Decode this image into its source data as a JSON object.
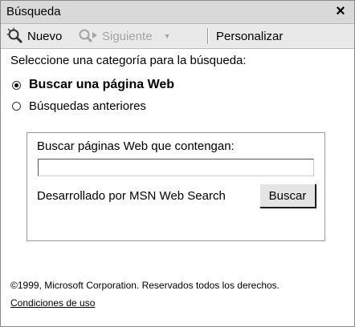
{
  "window": {
    "title": "Búsqueda",
    "close_glyph": "×"
  },
  "toolbar": {
    "new_label": "Nuevo",
    "new_icon": "search-new-icon",
    "next_label": "Siguiente",
    "next_icon": "search-next-icon",
    "dropdown_glyph": "▼",
    "customize_label": "Personalizar"
  },
  "main": {
    "prompt": "Seleccione una categoría para la búsqueda:",
    "options": [
      {
        "label": "Buscar una página Web",
        "selected": true
      },
      {
        "label": "Búsquedas anteriores",
        "selected": false
      }
    ],
    "search_box": {
      "label": "Buscar páginas Web que contengan:",
      "value": "",
      "powered_by": "Desarrollado por MSN Web Search",
      "button_label": "Buscar"
    },
    "footer": {
      "copyright": "©1999, Microsoft Corporation. Reservados todos los derechos.",
      "terms_link": "Condiciones de uso"
    }
  },
  "colors": {
    "titlebar_bg": "#d9d9d9",
    "toolbar_bg": "#e9e9e9",
    "disabled_text": "#a4a4a4"
  }
}
